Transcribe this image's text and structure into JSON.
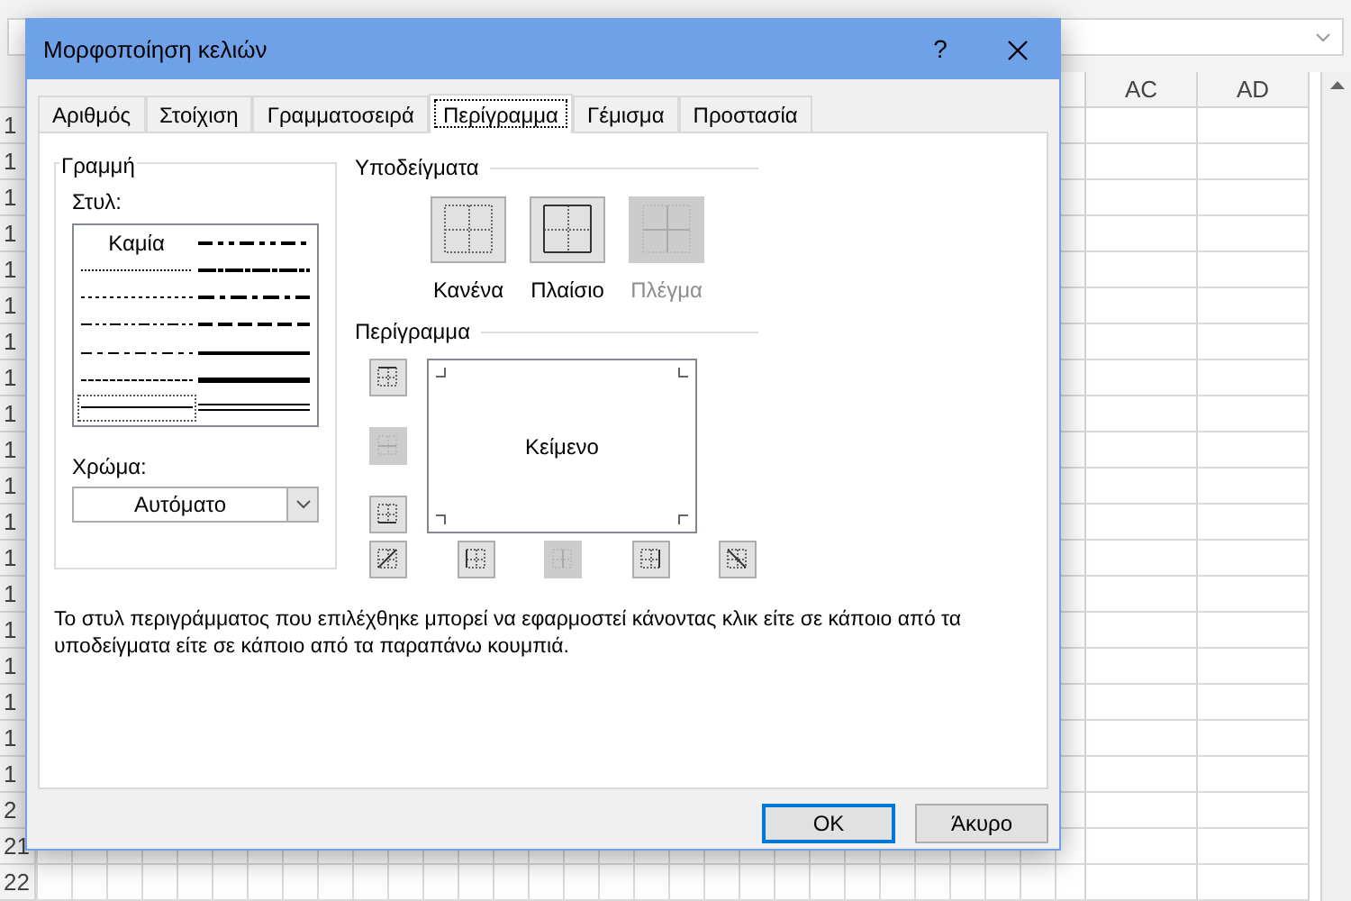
{
  "sheet": {
    "column_headers": [
      "AC",
      "AD"
    ],
    "row_headers": [
      "1",
      "1",
      "1",
      "1",
      "1",
      "1",
      "1",
      "1",
      "1",
      "1",
      "1",
      "1",
      "1",
      "1",
      "1",
      "1",
      "1",
      "1",
      "1",
      "2",
      "21",
      "22"
    ]
  },
  "dialog": {
    "title": "Μορφοποίηση κελιών",
    "help": "?",
    "tabs": [
      {
        "label": "Αριθμός",
        "selected": false
      },
      {
        "label": "Στοίχιση",
        "selected": false
      },
      {
        "label": "Γραμματοσειρά",
        "selected": false
      },
      {
        "label": "Περίγραμμα",
        "selected": true
      },
      {
        "label": "Γέμισμα",
        "selected": false
      },
      {
        "label": "Προστασία",
        "selected": false
      }
    ],
    "line": {
      "legend": "Γραμμή",
      "style_label": "Στυλ:",
      "color_label": "Χρώμα:",
      "color_value": "Αυτόματο",
      "styles": [
        {
          "kind": "none",
          "label": "Καμία",
          "selected": false
        },
        {
          "kind": "medium-dash-dot-dot",
          "selected": false
        },
        {
          "kind": "hair",
          "selected": false
        },
        {
          "kind": "slanted-dash-dot",
          "selected": false
        },
        {
          "kind": "dotted",
          "selected": false
        },
        {
          "kind": "medium-dash-dot",
          "selected": false
        },
        {
          "kind": "dash-dot-dot",
          "selected": false
        },
        {
          "kind": "medium-dashed",
          "selected": false
        },
        {
          "kind": "dash-dot",
          "selected": false
        },
        {
          "kind": "medium",
          "selected": false
        },
        {
          "kind": "dashed",
          "selected": false
        },
        {
          "kind": "thick",
          "selected": false
        },
        {
          "kind": "thin",
          "selected": true
        },
        {
          "kind": "double",
          "selected": false
        }
      ]
    },
    "presets": {
      "legend": "Υποδείγματα",
      "items": [
        {
          "kind": "none",
          "label": "Κανένα",
          "disabled": false
        },
        {
          "kind": "outline",
          "label": "Πλαίσιο",
          "disabled": false
        },
        {
          "kind": "inside",
          "label": "Πλέγμα",
          "disabled": true
        }
      ]
    },
    "border": {
      "legend": "Περίγραμμα",
      "preview_text": "Κείμενο",
      "side_buttons": [
        {
          "kind": "top",
          "disabled": false
        },
        {
          "kind": "middle-horizontal",
          "disabled": true
        },
        {
          "kind": "bottom",
          "disabled": false
        }
      ],
      "bottom_buttons": [
        {
          "kind": "diagonal-up",
          "disabled": false
        },
        {
          "kind": "left",
          "disabled": false
        },
        {
          "kind": "middle-vertical",
          "disabled": true
        },
        {
          "kind": "right",
          "disabled": false
        },
        {
          "kind": "diagonal-down",
          "disabled": false
        }
      ]
    },
    "note": "Το στυλ περιγράμματος που επιλέχθηκε μπορεί να εφαρμοστεί κάνοντας κλικ είτε σε κάποιο από τα υποδείγματα είτε σε κάποιο από τα παραπάνω κουμπιά.",
    "buttons": [
      {
        "label": "OK",
        "default": true
      },
      {
        "label": "Άκυρο",
        "default": false
      }
    ]
  }
}
